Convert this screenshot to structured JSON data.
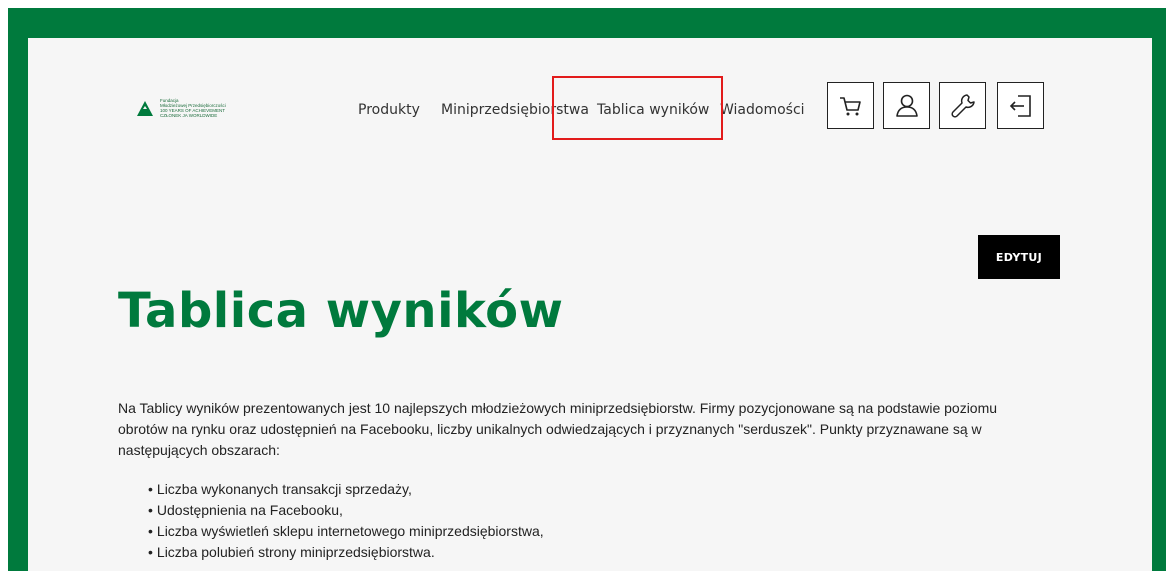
{
  "logo": {
    "lines": [
      "Fundacja",
      "Młodzieżowej Przedsiębiorczości",
      "100 YEARS OF ACHIEVEMENT",
      "CZŁONEK JA WORLDWIDE"
    ]
  },
  "nav": {
    "items": [
      {
        "label": "Produkty"
      },
      {
        "label": "Miniprzedsiębiorstwa"
      },
      {
        "label": "Tablica wyników"
      },
      {
        "label": "Wiadomości"
      }
    ]
  },
  "icons": [
    "cart-icon",
    "user-icon",
    "wrench-icon",
    "logout-icon"
  ],
  "edit_button": {
    "label": "EDYTUJ"
  },
  "page_title": "Tablica wyników",
  "intro": "Na Tablicy wyników prezentowanych jest 10 najlepszych młodzieżowych miniprzedsiębiorstw. Firmy pozycjonowane są na podstawie poziomu obrotów na rynku oraz udostępnień na Facebooku, liczby unikalnych odwiedzających i przyznanych \"serduszek\". Punkty przyznawane są w następujących obszarach:",
  "bullets": [
    "Liczba wykonanych transakcji sprzedaży,",
    "Udostępnienia na Facebooku,",
    "Liczba wyświetleń sklepu internetowego miniprzedsiębiorstwa,",
    "Liczba polubień strony miniprzedsiębiorstwa."
  ],
  "colors": {
    "brand_green": "#007a3d",
    "highlight_red": "#e21b1b"
  }
}
